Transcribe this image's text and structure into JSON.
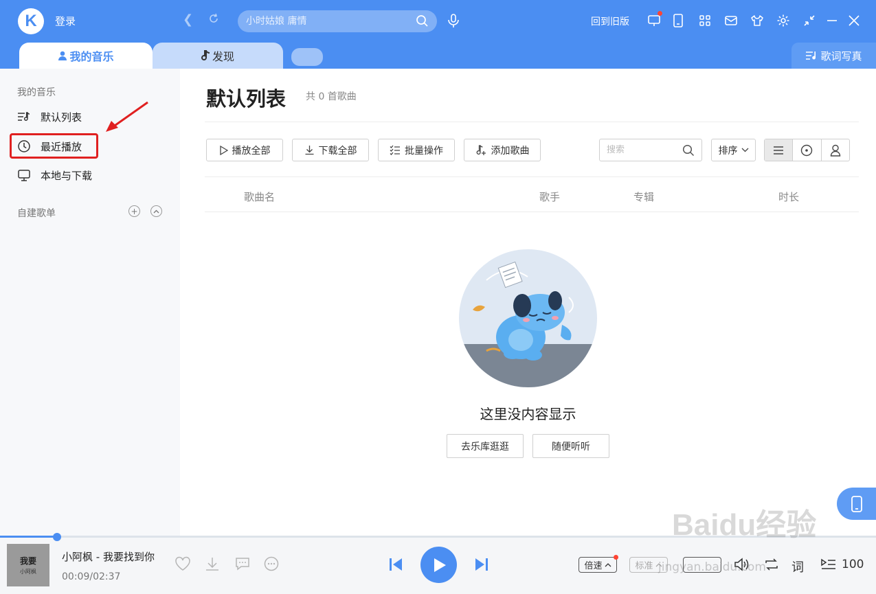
{
  "header": {
    "logo_letter": "K",
    "login": "登录",
    "search_placeholder": "小时姑娘 庸情",
    "old_version": "回到旧版"
  },
  "tabs": {
    "my_music": "我的音乐",
    "discover": "发现",
    "lyrics_photo": "歌词写真"
  },
  "sidebar": {
    "section_title": "我的音乐",
    "items": [
      {
        "label": "默认列表"
      },
      {
        "label": "最近播放"
      },
      {
        "label": "本地与下载"
      }
    ],
    "playlists_title": "自建歌单"
  },
  "main": {
    "title": "默认列表",
    "count": "共 0 首歌曲",
    "toolbar": {
      "play_all": "播放全部",
      "download_all": "下载全部",
      "batch": "批量操作",
      "add_song": "添加歌曲",
      "search_placeholder": "搜索",
      "sort": "排序"
    },
    "columns": [
      "歌曲名",
      "歌手",
      "专辑",
      "时长"
    ],
    "empty_text": "这里没内容显示",
    "empty_buttons": [
      "去乐库逛逛",
      "随便听听"
    ]
  },
  "player": {
    "album_line1": "我要",
    "album_line2": "小阿枫",
    "song": "小阿枫 - 我要找到你",
    "time": "00:09/02:37",
    "progress": 0.065,
    "speed": "倍速",
    "quality": "标准",
    "lyric": "词",
    "volume": "100"
  },
  "watermark": {
    "main": "Baidu经验",
    "sub": "jingyan.baidu.com"
  },
  "colors": {
    "accent": "#4b8ef2",
    "highlight": "#e02020"
  }
}
